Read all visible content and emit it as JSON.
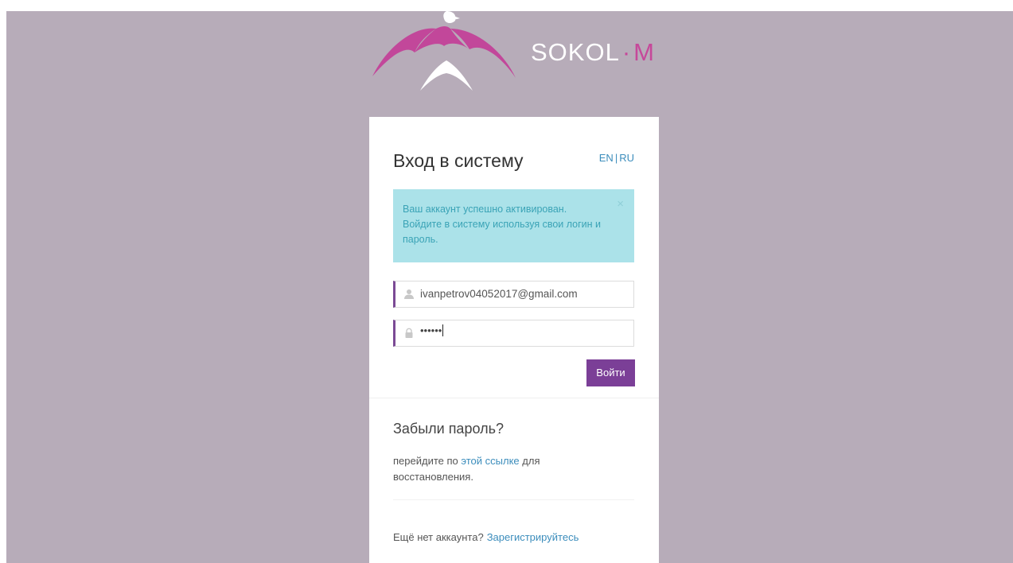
{
  "logo": {
    "brand_main": "SOKOL",
    "brand_dot": "·",
    "brand_suffix": "M",
    "accent_color": "#c6489a"
  },
  "login": {
    "title": "Вход в систему",
    "lang_en": "EN",
    "lang_sep": "|",
    "lang_ru": "RU",
    "alert_message": "Ваш аккаунт успешно активирован. Войдите в систему используя свои логин и пароль.",
    "alert_close": "×",
    "email_value": "ivanpetrov04052017@gmail.com",
    "password_masked": "••••••",
    "submit_label": "Войти"
  },
  "forgot": {
    "title": "Забыли пароль?",
    "text_before": "перейдите по",
    "link_text": "этой ссылке",
    "text_after": "для восстановления."
  },
  "register": {
    "prompt": "Ещё нет аккаунта?",
    "link_text": "Зарегистрируйтесь"
  },
  "colors": {
    "background": "#b7acb9",
    "button": "#7b3f97",
    "alert_bg": "#abe2e9",
    "link": "#3c8dbc"
  },
  "icons": {
    "user_field": "user-icon",
    "password_field": "lock-icon",
    "alert_close": "close-icon"
  }
}
